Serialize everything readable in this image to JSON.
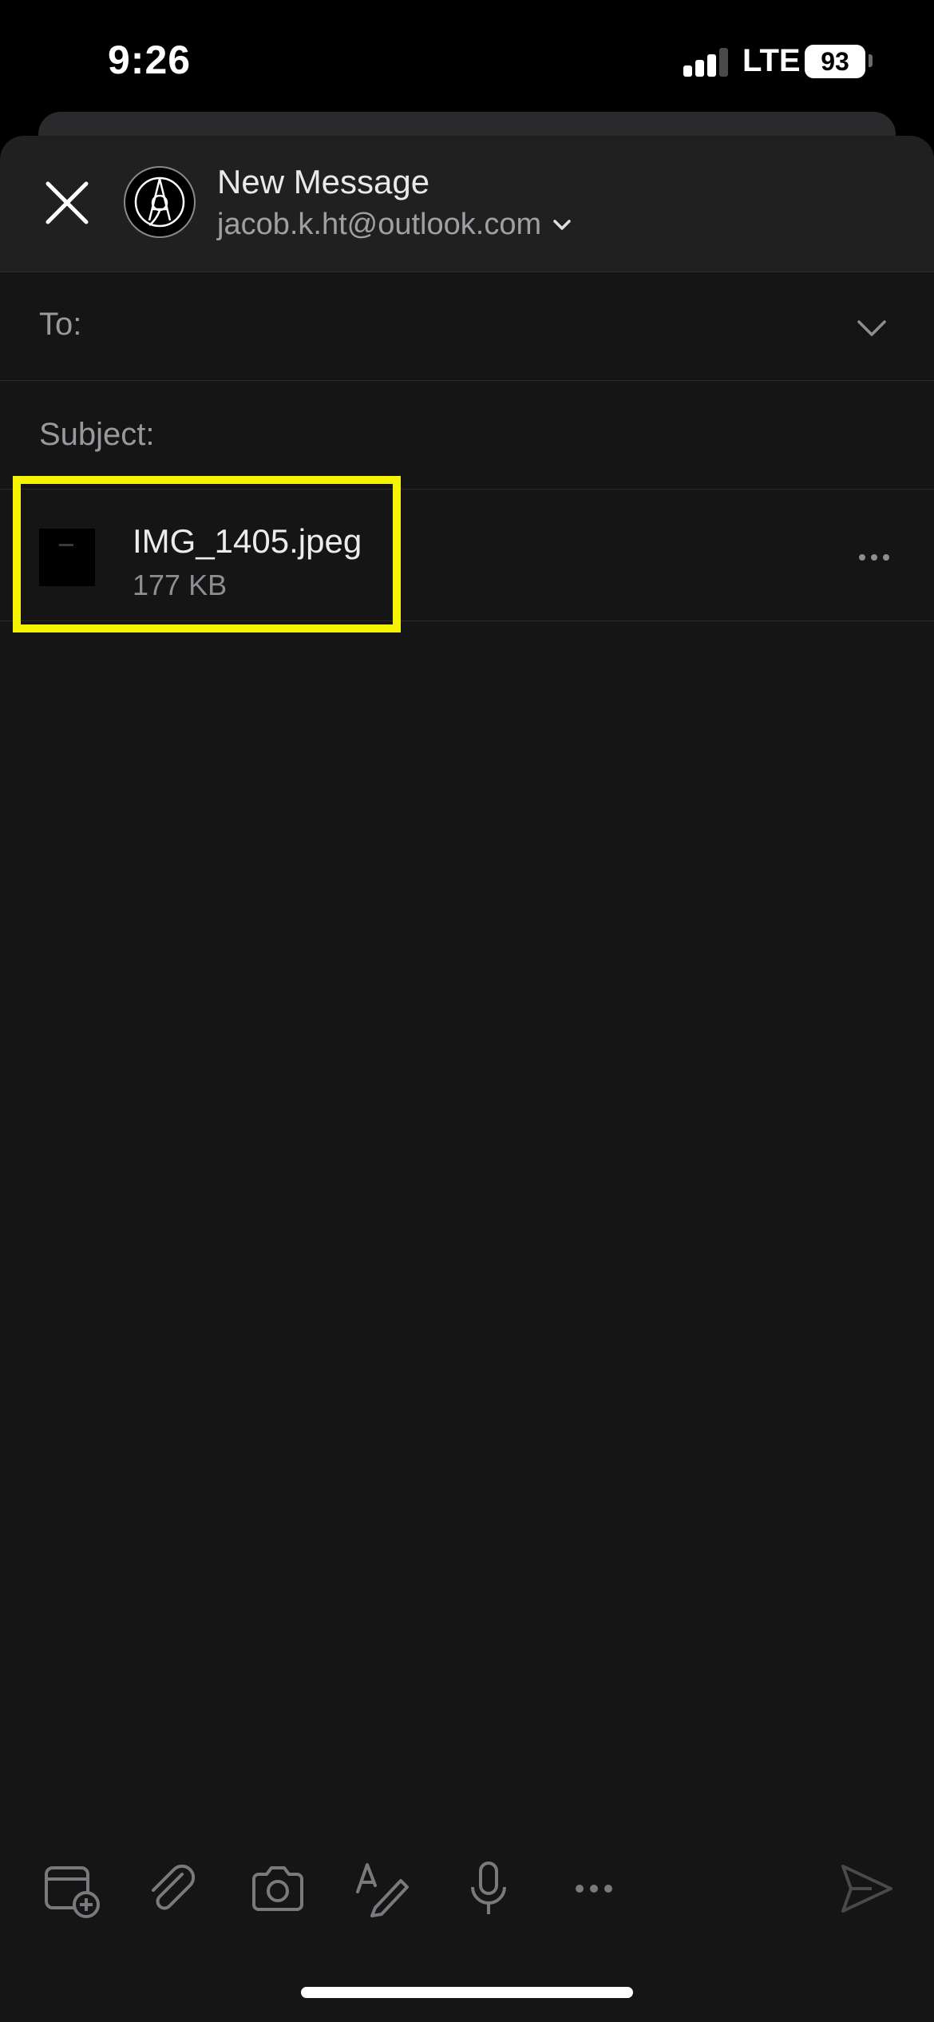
{
  "status_bar": {
    "time": "9:26",
    "network": "LTE",
    "battery": "93"
  },
  "header": {
    "title": "New Message",
    "from_email": "jacob.k.ht@outlook.com",
    "close_icon": "close-icon",
    "avatar_icon": "account-monogram-avatar"
  },
  "fields": {
    "to_label": "To:",
    "subject_label": "Subject:"
  },
  "attachment": {
    "filename": "IMG_1405.jpeg",
    "size": "177 KB",
    "highlight_color": "#f5f300"
  },
  "toolbar": {
    "icons": [
      "calendar-add-icon",
      "paperclip-icon",
      "camera-icon",
      "draw-icon",
      "microphone-icon",
      "more-icon",
      "send-icon"
    ]
  },
  "colors": {
    "background": "#151516",
    "header": "#202021",
    "text_secondary": "#9a9a9e"
  }
}
